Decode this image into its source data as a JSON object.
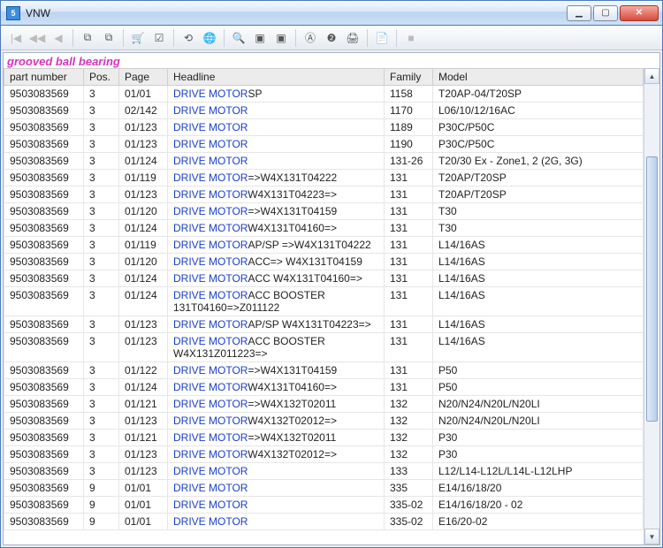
{
  "window": {
    "title": "VNW",
    "app_icon_text": "5"
  },
  "heading": "grooved ball bearing",
  "columns": {
    "part_number": "part number",
    "pos": "Pos.",
    "page": "Page",
    "headline": "Headline",
    "family": "Family",
    "model": "Model"
  },
  "rows": [
    {
      "pn": "9503083569",
      "pos": "3",
      "page": "01/01",
      "hl_link": "DRIVE MOTOR",
      "hl_tail": "SP",
      "family": "1158",
      "model": "T20AP-04/T20SP"
    },
    {
      "pn": "9503083569",
      "pos": "3",
      "page": "02/142",
      "hl_link": "DRIVE MOTOR",
      "hl_tail": "",
      "family": "1170",
      "model": "L06/10/12/16AC"
    },
    {
      "pn": "9503083569",
      "pos": "3",
      "page": "01/123",
      "hl_link": "DRIVE MOTOR",
      "hl_tail": "",
      "family": "1189",
      "model": "P30C/P50C"
    },
    {
      "pn": "9503083569",
      "pos": "3",
      "page": "01/123",
      "hl_link": "DRIVE MOTOR",
      "hl_tail": "",
      "family": "1190",
      "model": "P30C/P50C"
    },
    {
      "pn": "9503083569",
      "pos": "3",
      "page": "01/124",
      "hl_link": "DRIVE MOTOR",
      "hl_tail": "",
      "family": "131-26",
      "model": "T20/30 Ex - Zone1, 2 (2G, 3G)"
    },
    {
      "pn": "9503083569",
      "pos": "3",
      "page": "01/119",
      "hl_link": "DRIVE MOTOR",
      "hl_tail": "=>W4X131T04222",
      "family": "131",
      "model": "T20AP/T20SP"
    },
    {
      "pn": "9503083569",
      "pos": "3",
      "page": "01/123",
      "hl_link": "DRIVE MOTOR",
      "hl_tail": "W4X131T04223=>",
      "family": "131",
      "model": "T20AP/T20SP"
    },
    {
      "pn": "9503083569",
      "pos": "3",
      "page": "01/120",
      "hl_link": "DRIVE MOTOR",
      "hl_tail": "=>W4X131T04159",
      "family": "131",
      "model": "T30"
    },
    {
      "pn": "9503083569",
      "pos": "3",
      "page": "01/124",
      "hl_link": "DRIVE MOTOR",
      "hl_tail": "W4X131T04160=>",
      "family": "131",
      "model": "T30"
    },
    {
      "pn": "9503083569",
      "pos": "3",
      "page": "01/119",
      "hl_link": "DRIVE MOTOR",
      "hl_tail": "AP/SP =>W4X131T04222",
      "family": "131",
      "model": "L14/16AS"
    },
    {
      "pn": "9503083569",
      "pos": "3",
      "page": "01/120",
      "hl_link": "DRIVE MOTOR",
      "hl_tail": "ACC=> W4X131T04159",
      "family": "131",
      "model": "L14/16AS"
    },
    {
      "pn": "9503083569",
      "pos": "3",
      "page": "01/124",
      "hl_link": "DRIVE MOTOR",
      "hl_tail": "ACC  W4X131T04160=>",
      "family": "131",
      "model": "L14/16AS"
    },
    {
      "pn": "9503083569",
      "pos": "3",
      "page": "01/124",
      "hl_link": "DRIVE MOTOR",
      "hl_tail": "ACC BOOSTER 131T04160=>Z011122",
      "family": "131",
      "model": "L14/16AS"
    },
    {
      "pn": "9503083569",
      "pos": "3",
      "page": "01/123",
      "hl_link": "DRIVE MOTOR",
      "hl_tail": "AP/SP W4X131T04223=>",
      "family": "131",
      "model": "L14/16AS"
    },
    {
      "pn": "9503083569",
      "pos": "3",
      "page": "01/123",
      "hl_link": "DRIVE MOTOR",
      "hl_tail": "ACC BOOSTER W4X131Z011223=>",
      "family": "131",
      "model": "L14/16AS"
    },
    {
      "pn": "9503083569",
      "pos": "3",
      "page": "01/122",
      "hl_link": "DRIVE MOTOR",
      "hl_tail": "=>W4X131T04159",
      "family": "131",
      "model": "P50"
    },
    {
      "pn": "9503083569",
      "pos": "3",
      "page": "01/124",
      "hl_link": "DRIVE MOTOR",
      "hl_tail": "W4X131T04160=>",
      "family": "131",
      "model": "P50"
    },
    {
      "pn": "9503083569",
      "pos": "3",
      "page": "01/121",
      "hl_link": "DRIVE MOTOR",
      "hl_tail": "=>W4X132T02011",
      "family": "132",
      "model": "N20/N24/N20L/N20LI"
    },
    {
      "pn": "9503083569",
      "pos": "3",
      "page": "01/123",
      "hl_link": "DRIVE MOTOR",
      "hl_tail": "W4X132T02012=>",
      "family": "132",
      "model": "N20/N24/N20L/N20LI"
    },
    {
      "pn": "9503083569",
      "pos": "3",
      "page": "01/121",
      "hl_link": "DRIVE MOTOR",
      "hl_tail": "=>W4X132T02011",
      "family": "132",
      "model": "P30"
    },
    {
      "pn": "9503083569",
      "pos": "3",
      "page": "01/123",
      "hl_link": "DRIVE MOTOR",
      "hl_tail": "W4X132T02012=>",
      "family": "132",
      "model": "P30"
    },
    {
      "pn": "9503083569",
      "pos": "3",
      "page": "01/123",
      "hl_link": "DRIVE MOTOR",
      "hl_tail": "",
      "family": "133",
      "model": "L12/L14-L12L/L14L-L12LHP"
    },
    {
      "pn": "9503083569",
      "pos": "9",
      "page": "01/01",
      "hl_link": "DRIVE MOTOR",
      "hl_tail": "",
      "family": "335",
      "model": "E14/16/18/20"
    },
    {
      "pn": "9503083569",
      "pos": "9",
      "page": "01/01",
      "hl_link": "DRIVE MOTOR",
      "hl_tail": "",
      "family": "335-02",
      "model": "E14/16/18/20 - 02"
    },
    {
      "pn": "9503083569",
      "pos": "9",
      "page": "01/01",
      "hl_link": "DRIVE MOTOR",
      "hl_tail": "",
      "family": "335-02",
      "model": "E16/20-02"
    }
  ],
  "toolbar_icons": [
    "first",
    "prev-fast",
    "prev",
    "sep",
    "copy-left",
    "copy-right",
    "sep",
    "cart",
    "checklist",
    "sep",
    "nav-off",
    "globe",
    "sep",
    "zoom",
    "page1",
    "page2",
    "sep",
    "mark-a",
    "refresh",
    "print",
    "sep",
    "doc",
    "sep",
    "stop"
  ]
}
